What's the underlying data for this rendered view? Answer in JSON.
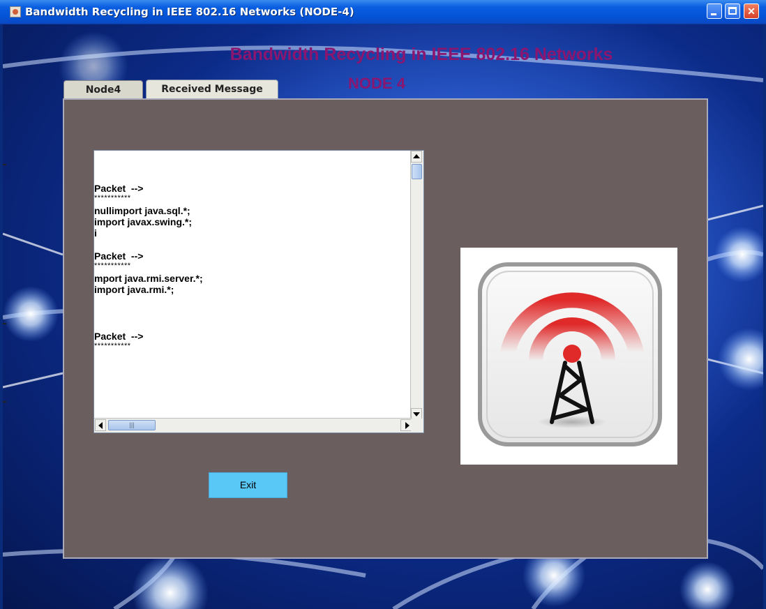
{
  "window": {
    "title": "Bandwidth Recycling in IEEE 802.16 Networks (NODE-4)"
  },
  "header": {
    "title": "Bandwidth Recycling in IEEE 802.16 Networks",
    "subtitle": "NODE 4"
  },
  "tabs": [
    {
      "label": "Node4",
      "selected": false
    },
    {
      "label": "Received Message",
      "selected": true
    }
  ],
  "message_area": {
    "lines": [
      {
        "text": "Packet  -->",
        "kind": "text"
      },
      {
        "text": "***********",
        "kind": "stars"
      },
      {
        "text": "nullimport java.sql.*;",
        "kind": "text"
      },
      {
        "text": "import javax.swing.*;",
        "kind": "text"
      },
      {
        "text": "i",
        "kind": "text"
      },
      {
        "text": "",
        "kind": "blank"
      },
      {
        "text": "Packet  -->",
        "kind": "text"
      },
      {
        "text": "***********",
        "kind": "stars"
      },
      {
        "text": "mport java.rmi.server.*;",
        "kind": "text"
      },
      {
        "text": "import java.rmi.*;",
        "kind": "text"
      },
      {
        "text": "",
        "kind": "blank"
      },
      {
        "text": "",
        "kind": "blank"
      },
      {
        "text": "",
        "kind": "blank"
      },
      {
        "text": "Packet  -->",
        "kind": "text"
      },
      {
        "text": "***********",
        "kind": "stars"
      }
    ]
  },
  "exit_button": {
    "label": "Exit"
  },
  "image": {
    "icon": "wireless-tower-icon"
  },
  "colors": {
    "heading": "#8a1670",
    "panel": "#6b5e5e",
    "exit_button": "#5ac8f6",
    "signal": "#e02a2a"
  }
}
